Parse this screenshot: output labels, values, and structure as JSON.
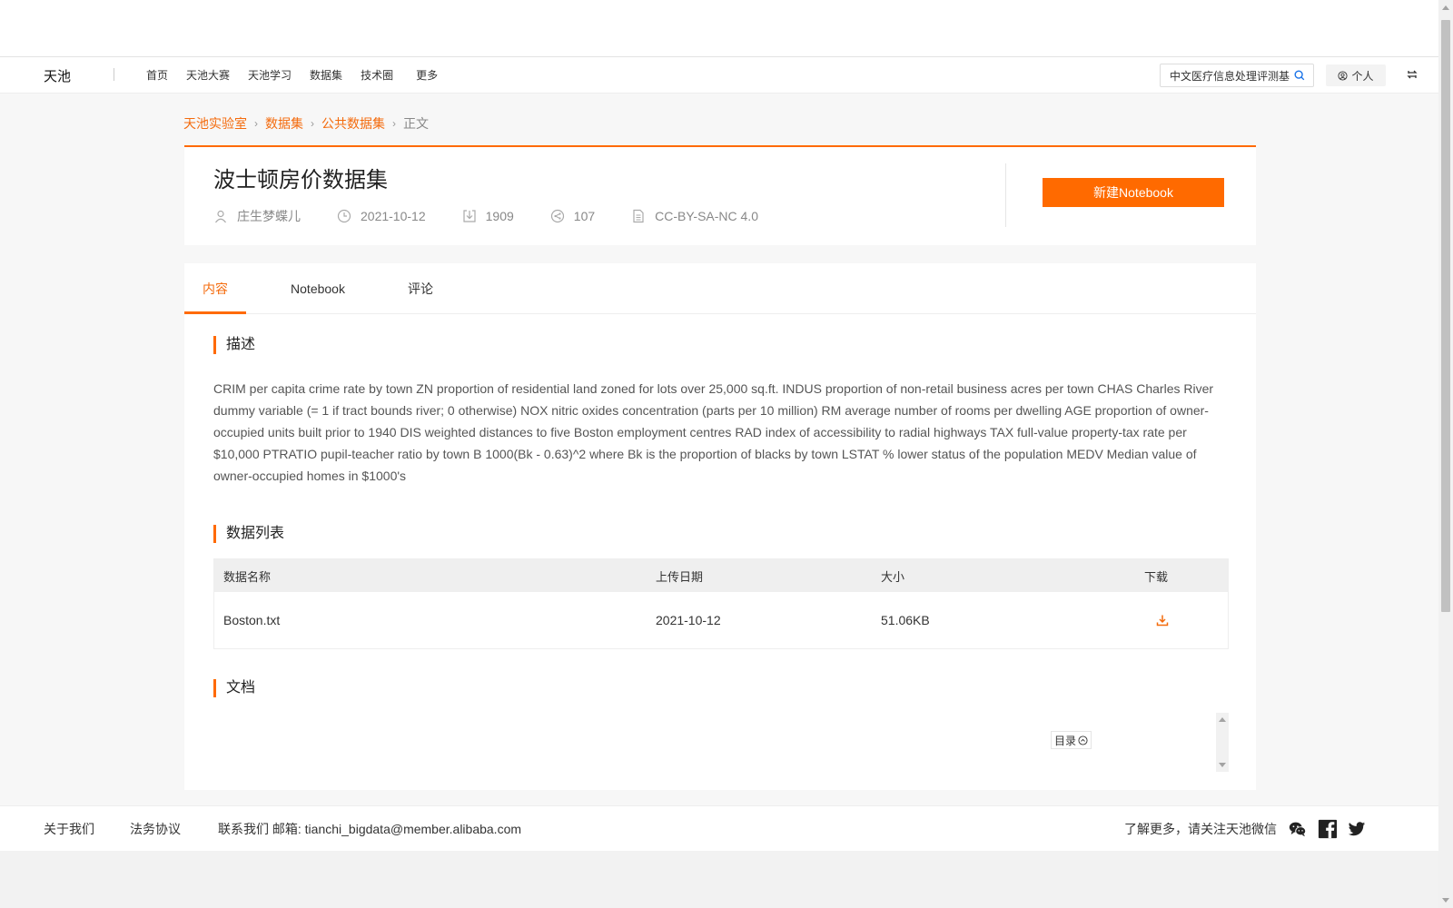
{
  "nav": {
    "logo": "天池",
    "items": [
      "首页",
      "天池大赛",
      "天池学习",
      "数据集",
      "技术圈"
    ],
    "more": "更多",
    "search_value": "中文医疗信息处理评测基",
    "personal": "个人"
  },
  "breadcrumb": {
    "items": [
      "天池实验室",
      "数据集",
      "公共数据集"
    ],
    "current": "正文"
  },
  "dataset": {
    "title": "波士顿房价数据集",
    "author": "庄生梦蝶儿",
    "date": "2021-10-12",
    "downloads": "1909",
    "shares": "107",
    "license": "CC-BY-SA-NC 4.0",
    "new_notebook": "新建Notebook"
  },
  "tabs": {
    "content": "内容",
    "notebook": "Notebook",
    "comments": "评论"
  },
  "sections": {
    "description": "描述",
    "data_list": "数据列表",
    "docs": "文档"
  },
  "description_text": "CRIM per capita crime rate by town ZN proportion of residential land zoned for lots over 25,000 sq.ft. INDUS proportion of non-retail business acres per town CHAS Charles River dummy variable (= 1 if tract bounds river; 0 otherwise) NOX nitric oxides concentration (parts per 10 million) RM average number of rooms per dwelling AGE proportion of owner-occupied units built prior to 1940 DIS weighted distances to five Boston employment centres RAD index of accessibility to radial highways TAX full-value property-tax rate per $10,000 PTRATIO pupil-teacher ratio by town B 1000(Bk - 0.63)^2 where Bk is the proportion of blacks by town LSTAT % lower status of the population MEDV Median value of owner-occupied homes in $1000's",
  "table": {
    "headers": {
      "name": "数据名称",
      "date": "上传日期",
      "size": "大小",
      "download": "下载"
    },
    "rows": [
      {
        "name": "Boston.txt",
        "date": "2021-10-12",
        "size": "51.06KB"
      }
    ]
  },
  "docs": {
    "toc": "目录"
  },
  "footer": {
    "about": "关于我们",
    "legal": "法务协议",
    "contact": "联系我们 邮箱: tianchi_bigdata@member.alibaba.com",
    "follow": "了解更多，请关注天池微信"
  },
  "colors": {
    "accent": "#ff6a00",
    "link": "#f46b0d"
  }
}
